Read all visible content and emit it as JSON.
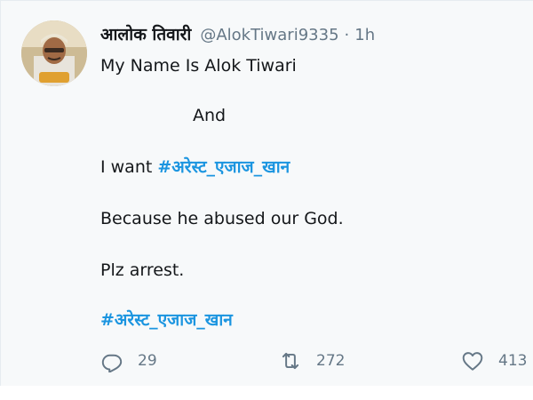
{
  "tweet": {
    "display_name": "आलोक तिवारी",
    "handle": "@AlokTiwari9335",
    "separator": "·",
    "time": "1h",
    "lines": {
      "l1": "My Name Is Alok Tiwari",
      "l2": "And",
      "l3_prefix": "I want ",
      "l3_hashtag": "#अरेस्ट_एजाज_खान",
      "l4": "Because he abused our God.",
      "l5": "Plz arrest.",
      "l6_hashtag": "#अरेस्ट_एजाज_खान"
    },
    "actions": {
      "reply_count": "29",
      "retweet_count": "272",
      "like_count": "413"
    },
    "colors": {
      "hashtag": "#1b95e0",
      "muted": "#657786",
      "text": "#14171a",
      "background": "#f7f9fa"
    },
    "icons": {
      "reply": "reply-icon",
      "retweet": "retweet-icon",
      "like": "heart-icon"
    }
  }
}
